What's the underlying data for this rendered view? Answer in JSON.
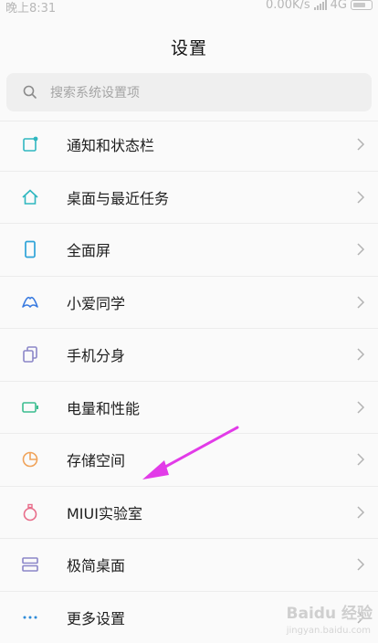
{
  "status_bar": {
    "time": "晚上8:31",
    "net_speed": "0.00K/s",
    "network": "4G"
  },
  "header": {
    "title": "设置"
  },
  "search": {
    "placeholder": "搜索系统设置项"
  },
  "items": [
    {
      "label": "通知和状态栏",
      "icon": "notification-icon",
      "color": "#2fb7c0"
    },
    {
      "label": "桌面与最近任务",
      "icon": "home-icon",
      "color": "#2fb7c0"
    },
    {
      "label": "全面屏",
      "icon": "phone-icon",
      "color": "#2ea3d8"
    },
    {
      "label": "小爱同学",
      "icon": "xiaoai-icon",
      "color": "#3a7be0"
    },
    {
      "label": "手机分身",
      "icon": "dual-copy-icon",
      "color": "#8b86c8"
    },
    {
      "label": "电量和性能",
      "icon": "battery-icon",
      "color": "#3bbd8f"
    },
    {
      "label": "存储空间",
      "icon": "pie-chart-icon",
      "color": "#f0a35a"
    },
    {
      "label": "MIUI实验室",
      "icon": "flask-icon",
      "color": "#e86d8a"
    },
    {
      "label": "极简桌面",
      "icon": "layers-icon",
      "color": "#8b86c8"
    },
    {
      "label": "更多设置",
      "icon": "more-icon",
      "color": "#2e8bd8"
    }
  ],
  "watermark": {
    "text": "Baidu 经验",
    "sub": "jingyan.baidu.com"
  },
  "colors": {
    "annotation_arrow": "#e23be8"
  }
}
